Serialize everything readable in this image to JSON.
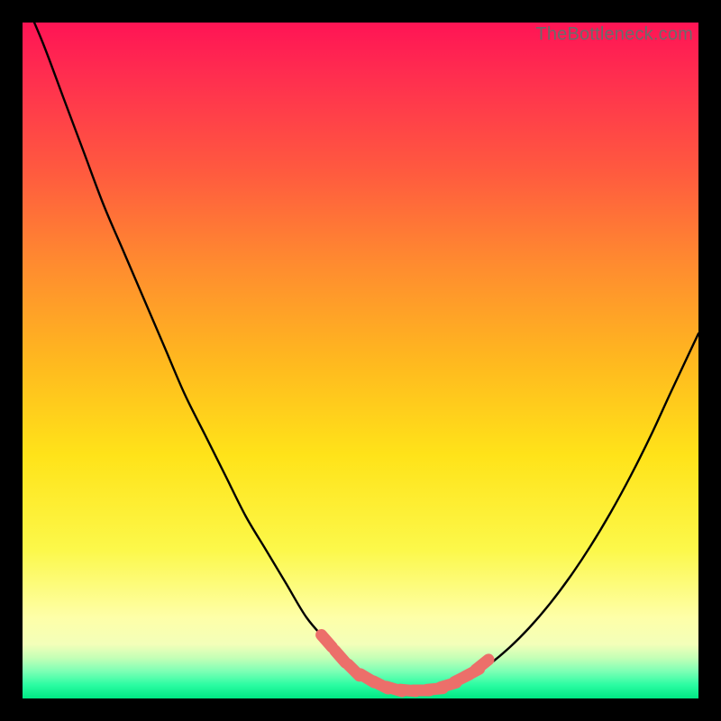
{
  "watermark": {
    "text": "TheBottleneck.com"
  },
  "colors": {
    "frame": "#000000",
    "curve_stroke": "#000000",
    "marker_fill": "#ec6f6a",
    "marker_stroke": "#ec6f6a",
    "gradient_top": "#ff1455",
    "gradient_bottom": "#00e884"
  },
  "chart_data": {
    "type": "line",
    "title": "",
    "xlabel": "",
    "ylabel": "",
    "xlim": [
      0,
      100
    ],
    "ylim": [
      0,
      100
    ],
    "grid": false,
    "note": "No axis ticks or numeric labels visible; values estimated from position. Curve is a V-shaped bottleneck profile; markers cluster near the minimum.",
    "series": [
      {
        "name": "bottleneck-curve",
        "kind": "line",
        "x": [
          0,
          3,
          6,
          9,
          12,
          15,
          18,
          21,
          24,
          27,
          30,
          33,
          36,
          39,
          42,
          45,
          48,
          51,
          54,
          57,
          60,
          63,
          66,
          69,
          72,
          75,
          78,
          81,
          84,
          87,
          90,
          93,
          96,
          100
        ],
        "y": [
          104,
          97,
          89,
          81,
          73,
          66,
          59,
          52,
          45,
          39,
          33,
          27,
          22,
          17,
          12,
          8.5,
          5.2,
          3.0,
          1.8,
          1.2,
          1.2,
          1.8,
          3.0,
          5.0,
          7.5,
          10.5,
          14.0,
          18.0,
          22.5,
          27.5,
          33.0,
          39.0,
          45.5,
          54.0
        ]
      },
      {
        "name": "marker-points",
        "kind": "scatter",
        "x": [
          45,
          47,
          49,
          51,
          53,
          55,
          57,
          59,
          61,
          63,
          65,
          66.5,
          68
        ],
        "y": [
          8.5,
          6.2,
          4.2,
          3.0,
          2.0,
          1.4,
          1.2,
          1.2,
          1.4,
          2.0,
          3.0,
          3.8,
          5.0
        ]
      }
    ]
  }
}
